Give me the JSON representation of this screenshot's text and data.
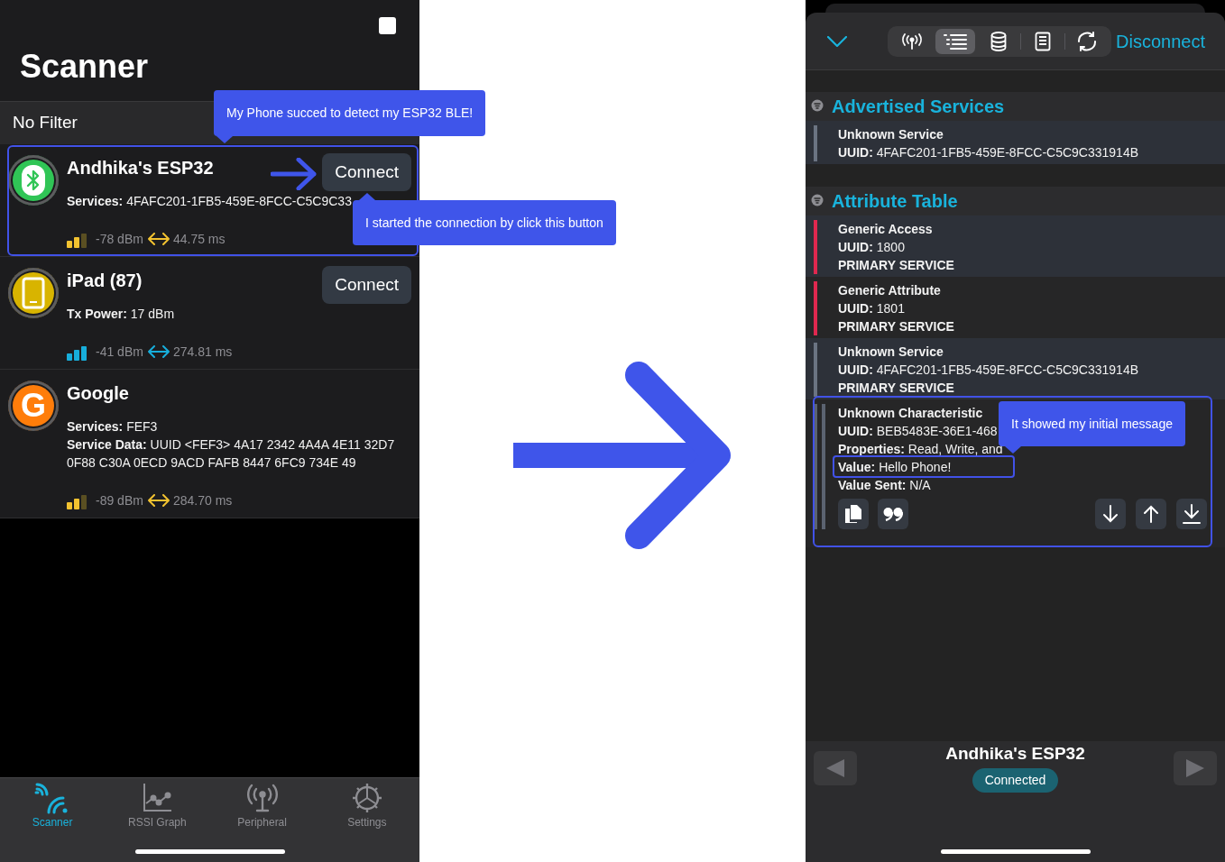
{
  "scanner": {
    "title": "Scanner",
    "filter": "No Filter",
    "devices": [
      {
        "name": "Andhika's ESP32",
        "kind": "bluetooth",
        "color": "#30c556",
        "details": [
          "**Services:** 4FAFC201-1FB5-459E-8FCC-C5C9C33"
        ],
        "weak_signal": true,
        "rssi": "-78 dBm",
        "interval": "44.75 ms",
        "button": "Connect",
        "outlined": true
      },
      {
        "name": "iPad (87)",
        "kind": "tablet",
        "color": "#d8b400",
        "details": [
          "**Tx Power:** 17 dBm"
        ],
        "weak_signal": false,
        "rssi": "-41 dBm",
        "interval": "274.81 ms",
        "button": "Connect",
        "outlined": false
      },
      {
        "name": "Google",
        "kind": "letter",
        "letter": "G",
        "color": "#ff7d0a",
        "details": [
          "**Services:** FEF3",
          "**Service Data:** UUID <FEF3> 4A17 2342 4A4A 4E11 32D7 0F88 C30A 0ECD 9ACD FAFB 8447 6FC9 734E 49"
        ],
        "weak_signal": true,
        "rssi": "-89 dBm",
        "interval": "284.70 ms",
        "outlined": false
      }
    ],
    "tabs": [
      {
        "label": "Scanner",
        "kind": "scanner",
        "selected": true
      },
      {
        "label": "RSSI Graph",
        "kind": "graph",
        "selected": false
      },
      {
        "label": "Peripheral",
        "kind": "antenna",
        "selected": false
      },
      {
        "label": "Settings",
        "kind": "gear",
        "selected": false
      }
    ]
  },
  "annotations": {
    "callouts": [
      "My Phone succed to detect my ESP32 BLE!",
      "I started the connection by click this button",
      "It showed my initial message"
    ]
  },
  "peripheral": {
    "toolbar": {
      "segments": [
        {
          "kind": "antenna",
          "selected": false
        },
        {
          "kind": "list",
          "selected": true
        },
        {
          "kind": "database",
          "selected": false
        },
        {
          "kind": "document",
          "selected": false
        },
        {
          "kind": "refresh",
          "selected": false
        }
      ],
      "action": "Disconnect"
    },
    "sections": [
      {
        "title": "Advertised Services",
        "items": [
          {
            "kind": "service",
            "color": "#6b7482",
            "title": "Unknown Service",
            "details": [
              "**UUID:** 4FAFC201-1FB5-459E-8FCC-C5C9C331914B"
            ]
          }
        ]
      },
      {
        "title": "Attribute Table",
        "items": [
          {
            "kind": "service",
            "color": "#e0284f",
            "title": "Generic Access",
            "details": [
              "**UUID:** 1800"
            ],
            "type": "PRIMARY SERVICE"
          },
          {
            "kind": "service",
            "color": "#e0284f",
            "title": "Generic Attribute",
            "details": [
              "**UUID:** 1801"
            ],
            "type": "PRIMARY SERVICE"
          },
          {
            "kind": "service",
            "color": "#6b7482",
            "title": "Unknown Service",
            "details": [
              "**UUID:** 4FAFC201-1FB5-459E-8FCC-C5C9C331914B"
            ],
            "type": "PRIMARY SERVICE"
          },
          {
            "kind": "characteristic",
            "color": "#5b6370",
            "title": "Unknown Characteristic",
            "details": [
              "**UUID:** BEB5483E-36E1-468",
              "**Properties:** Read, Write, and"
            ],
            "value": "**Value:** Hello Phone!",
            "value_outlined": true,
            "value_sent": "**Value Sent:** N/A",
            "outlined": true
          }
        ]
      }
    ],
    "footer": {
      "device": "Andhika's ESP32",
      "status": "Connected"
    }
  }
}
